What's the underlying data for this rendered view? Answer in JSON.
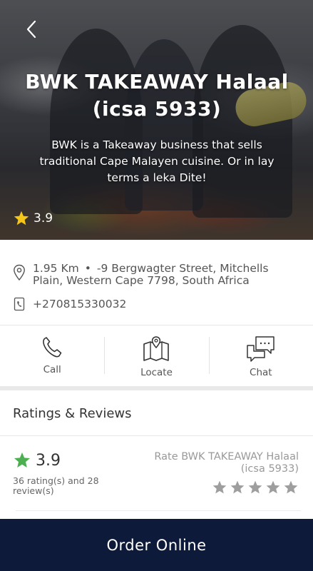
{
  "restaurant": {
    "name": "BWK TAKEAWAY Halaal (icsa 5933)",
    "description": "BWK is a Takeaway business that sells traditional Cape Malayen cuisine. Or in lay terms a leka Dite!",
    "rating": "3.9"
  },
  "info": {
    "distance": "1.95 Km",
    "separator": "•",
    "address": "-9 Bergwagter Street, Mitchells Plain, Western Cape 7798, South Africa",
    "phone": "+270815330032"
  },
  "actions": [
    {
      "label": "Call",
      "icon": "phone-icon"
    },
    {
      "label": "Locate",
      "icon": "map-icon"
    },
    {
      "label": "Chat",
      "icon": "chat-icon"
    }
  ],
  "reviews": {
    "section_title": "Ratings & Reviews",
    "average": "3.9",
    "counts": "36 rating(s) and 28 review(s)",
    "rate_prompt": "Rate BWK TAKEAWAY Halaal (icsa 5933)",
    "rate_max": 5
  },
  "order": {
    "label": "Order Online"
  },
  "colors": {
    "star_gold": "#f5c518",
    "star_green": "#4caf50",
    "star_empty": "#9e9e9e",
    "order_bar": "#0d1a3a"
  }
}
